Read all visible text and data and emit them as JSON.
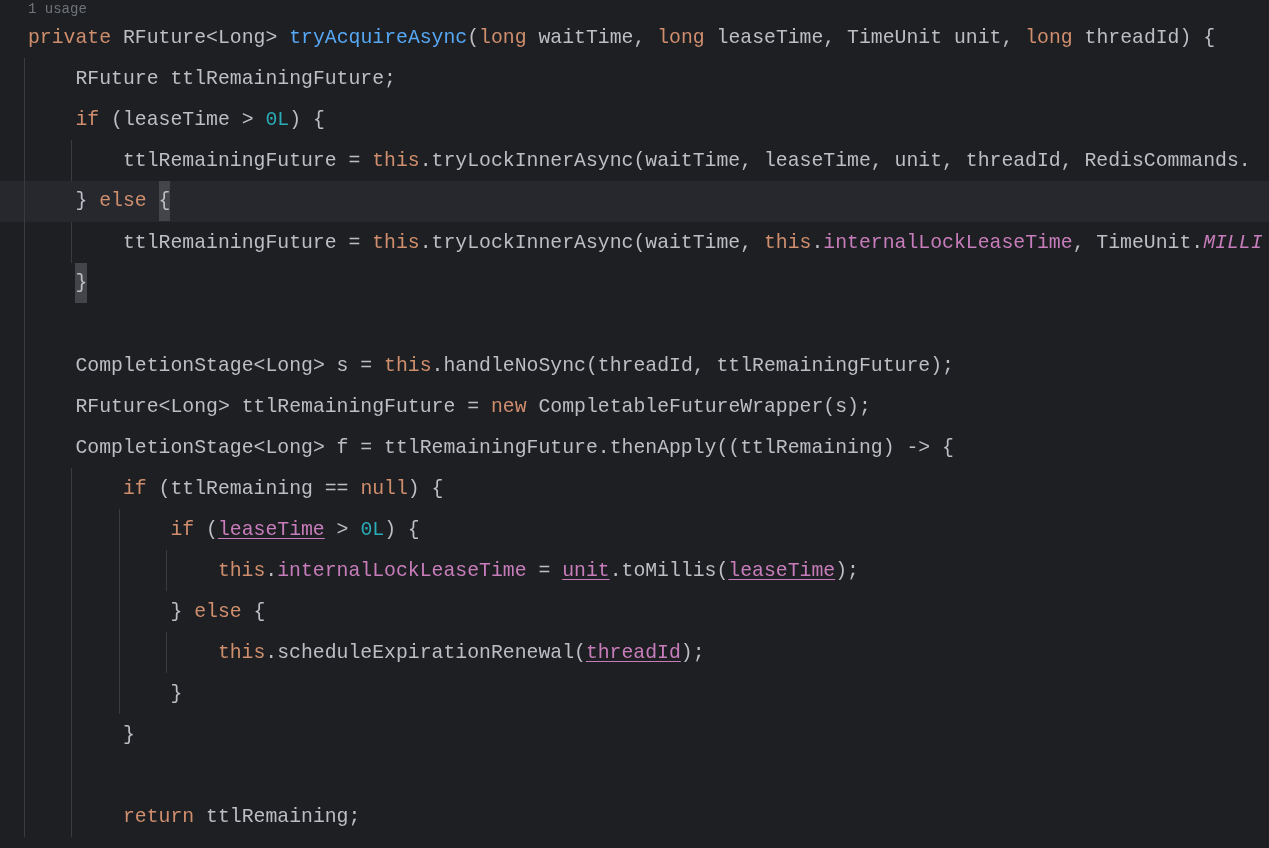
{
  "usage_hint": "1 usage",
  "lines": [
    {
      "current": false,
      "tokens": [
        {
          "text": "private",
          "kind": "keyword"
        },
        {
          "text": " RFuture<Long> ",
          "kind": "plain"
        },
        {
          "text": "tryAcquireAsync",
          "kind": "method"
        },
        {
          "text": "(",
          "kind": "plain"
        },
        {
          "text": "long",
          "kind": "keyword"
        },
        {
          "text": " waitTime, ",
          "kind": "plain"
        },
        {
          "text": "long",
          "kind": "keyword"
        },
        {
          "text": " leaseTime, TimeUnit unit, ",
          "kind": "plain"
        },
        {
          "text": "long",
          "kind": "keyword"
        },
        {
          "text": " threadId) {",
          "kind": "plain"
        }
      ],
      "children": [
        {
          "current": false,
          "tokens": [
            {
              "text": "RFuture ttlRemainingFuture;",
              "kind": "plain"
            }
          ]
        },
        {
          "current": false,
          "tokens": [
            {
              "text": "if",
              "kind": "keyword"
            },
            {
              "text": " (leaseTime > ",
              "kind": "plain"
            },
            {
              "text": "0L",
              "kind": "number"
            },
            {
              "text": ") {",
              "kind": "plain"
            }
          ],
          "children": [
            {
              "current": false,
              "tokens": [
                {
                  "text": "ttlRemainingFuture = ",
                  "kind": "plain"
                },
                {
                  "text": "this",
                  "kind": "keyword"
                },
                {
                  "text": ".tryLockInnerAsync(waitTime, leaseTime, unit, threadId, RedisCommands.",
                  "kind": "plain"
                }
              ]
            }
          ]
        },
        {
          "current": true,
          "tokens": [
            {
              "text": "} ",
              "kind": "plain"
            },
            {
              "text": "else ",
              "kind": "keyword"
            },
            {
              "text": "{",
              "kind": "brace_match"
            }
          ],
          "children": [
            {
              "current": false,
              "tokens": [
                {
                  "text": "ttlRemainingFuture = ",
                  "kind": "plain"
                },
                {
                  "text": "this",
                  "kind": "keyword"
                },
                {
                  "text": ".tryLockInnerAsync(waitTime, ",
                  "kind": "plain"
                },
                {
                  "text": "this",
                  "kind": "keyword"
                },
                {
                  "text": ".",
                  "kind": "plain"
                },
                {
                  "text": "internalLockLeaseTime",
                  "kind": "field"
                },
                {
                  "text": ", TimeUnit.",
                  "kind": "plain"
                },
                {
                  "text": "MILLI",
                  "kind": "constant"
                }
              ]
            }
          ]
        },
        {
          "current": false,
          "tokens": [
            {
              "text": "}",
              "kind": "brace_match"
            }
          ]
        },
        {
          "current": false
        },
        {
          "current": false,
          "tokens": [
            {
              "text": "CompletionStage<Long> s = ",
              "kind": "plain"
            },
            {
              "text": "this",
              "kind": "keyword"
            },
            {
              "text": ".handleNoSync(threadId, ttlRemainingFuture);",
              "kind": "plain"
            }
          ]
        },
        {
          "current": false,
          "tokens": [
            {
              "text": "RFuture<Long> ttlRemainingFuture = ",
              "kind": "plain"
            },
            {
              "text": "new",
              "kind": "keyword"
            },
            {
              "text": " CompletableFutureWrapper(s);",
              "kind": "plain"
            }
          ]
        },
        {
          "current": false,
          "tokens": [
            {
              "text": "CompletionStage<Long> f = ttlRemainingFuture.thenApply((ttlRemaining) -> {",
              "kind": "plain"
            }
          ],
          "children": [
            {
              "current": false,
              "tokens": [
                {
                  "text": "if",
                  "kind": "keyword"
                },
                {
                  "text": " (ttlRemaining == ",
                  "kind": "plain"
                },
                {
                  "text": "null",
                  "kind": "keyword"
                },
                {
                  "text": ") {",
                  "kind": "plain"
                }
              ],
              "children": [
                {
                  "current": false,
                  "tokens": [
                    {
                      "text": "if",
                      "kind": "keyword"
                    },
                    {
                      "text": " (",
                      "kind": "plain"
                    },
                    {
                      "text": "leaseTime",
                      "kind": "captured"
                    },
                    {
                      "text": " > ",
                      "kind": "plain"
                    },
                    {
                      "text": "0L",
                      "kind": "number"
                    },
                    {
                      "text": ") {",
                      "kind": "plain"
                    }
                  ],
                  "children": [
                    {
                      "current": false,
                      "tokens": [
                        {
                          "text": "this",
                          "kind": "keyword"
                        },
                        {
                          "text": ".",
                          "kind": "plain"
                        },
                        {
                          "text": "internalLockLeaseTime",
                          "kind": "field"
                        },
                        {
                          "text": " = ",
                          "kind": "plain"
                        },
                        {
                          "text": "unit",
                          "kind": "captured"
                        },
                        {
                          "text": ".toMillis(",
                          "kind": "plain"
                        },
                        {
                          "text": "leaseTime",
                          "kind": "captured"
                        },
                        {
                          "text": ");",
                          "kind": "plain"
                        }
                      ]
                    }
                  ]
                },
                {
                  "current": false,
                  "tokens": [
                    {
                      "text": "} ",
                      "kind": "plain"
                    },
                    {
                      "text": "else",
                      "kind": "keyword"
                    },
                    {
                      "text": " {",
                      "kind": "plain"
                    }
                  ],
                  "children": [
                    {
                      "current": false,
                      "tokens": [
                        {
                          "text": "this",
                          "kind": "keyword"
                        },
                        {
                          "text": ".scheduleExpirationRenewal(",
                          "kind": "plain"
                        },
                        {
                          "text": "threadId",
                          "kind": "captured"
                        },
                        {
                          "text": ");",
                          "kind": "plain"
                        }
                      ]
                    }
                  ]
                },
                {
                  "current": false,
                  "tokens": [
                    {
                      "text": "}",
                      "kind": "plain"
                    }
                  ]
                }
              ]
            },
            {
              "current": false,
              "tokens": [
                {
                  "text": "}",
                  "kind": "plain"
                }
              ]
            },
            {
              "current": false
            },
            {
              "current": false,
              "tokens": [
                {
                  "text": "return",
                  "kind": "keyword"
                },
                {
                  "text": " ttlRemaining;",
                  "kind": "plain"
                }
              ]
            }
          ]
        }
      ]
    }
  ]
}
